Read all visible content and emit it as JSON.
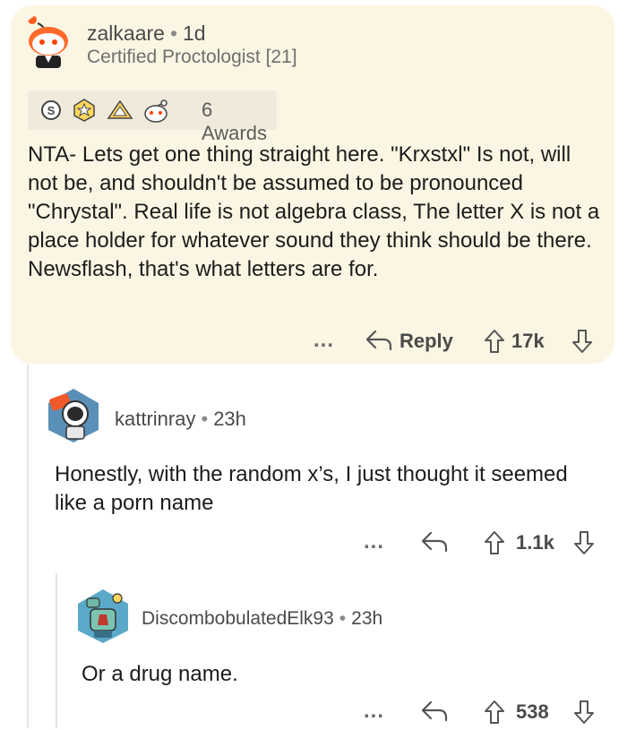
{
  "comments": [
    {
      "username": "zalkaare",
      "age": "1d",
      "flair": "Certified Proctologist [21]",
      "awards_label": "6 Awards",
      "text": "NTA- Lets get one thing straight here. \"Krxstxl\" Is not, will not be, and shouldn't be assumed to be pronounced \"Chrystal\". Real life is not algebra class, The letter X is not a place holder for whatever sound they think should be there. Newsflash, that's what letters are for.",
      "more": "...",
      "reply_label": "Reply",
      "score": "17k"
    },
    {
      "username": "kattrinray",
      "age": "23h",
      "text": "Honestly, with the random x’s, I just thought it seemed like a porn name",
      "more": "...",
      "score": "1.1k"
    },
    {
      "username": "DiscombobulatedElk93",
      "age": "23h",
      "text": "Or a drug name.",
      "more": "...",
      "score": "538"
    }
  ],
  "colors": {
    "card_bg": "#fbf6e3",
    "awards_bg": "#efeadb",
    "thread_line": "#e5e5e5"
  },
  "icons": [
    "snoo-avatar",
    "astronaut-avatar",
    "robot-avatar",
    "silver-award-icon",
    "gold-star-award-icon",
    "helpful-award-icon",
    "snoo-award-icon",
    "reply-arrow-icon",
    "upvote-icon",
    "downvote-icon"
  ]
}
